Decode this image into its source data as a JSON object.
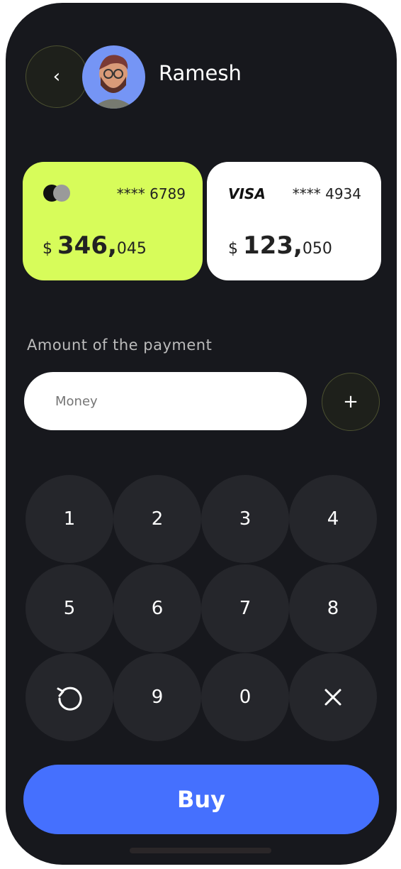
{
  "header": {
    "name": "Ramesh"
  },
  "cards": [
    {
      "brand": "mastercard",
      "number": "**** 6789",
      "currency": "$",
      "amount_main": "346,",
      "amount_cents": "045",
      "color": "#d7fc5a"
    },
    {
      "brand": "VISA",
      "number": "**** 4934",
      "currency": "$",
      "amount_main": "123,",
      "amount_cents": "050",
      "color": "#ffffff"
    }
  ],
  "payment": {
    "label": "Amount of the payment",
    "placeholder": "Money"
  },
  "keypad": [
    "1",
    "2",
    "3",
    "4",
    "5",
    "6",
    "7",
    "8",
    "reset",
    "9",
    "0",
    "clear"
  ],
  "buy_label": "Buy",
  "accent": "#4570fe"
}
